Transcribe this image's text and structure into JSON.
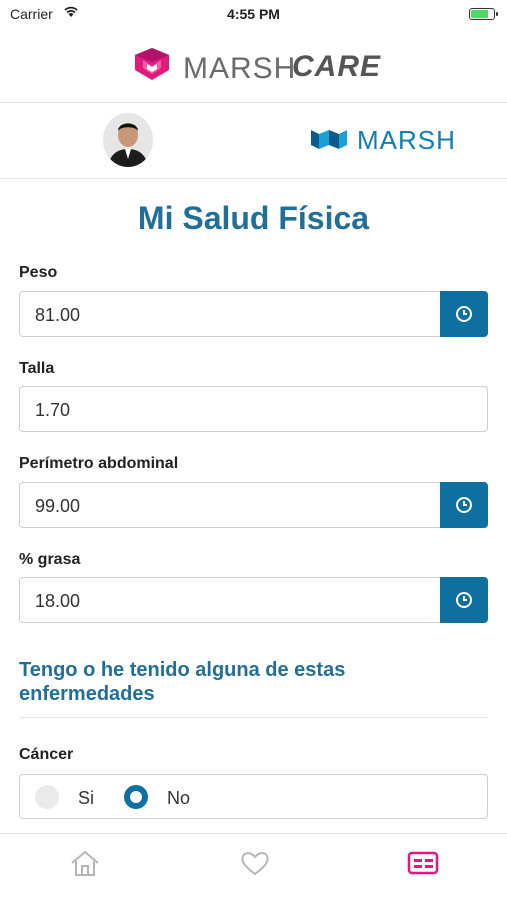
{
  "status_bar": {
    "carrier": "Carrier",
    "time": "4:55 PM"
  },
  "brand": {
    "name": "MARSH",
    "suffix": "CARE"
  },
  "partner": {
    "name": "MARSH"
  },
  "page": {
    "title": "Mi Salud Física"
  },
  "fields": [
    {
      "label": "Peso",
      "value": "81.00",
      "has_history": true
    },
    {
      "label": "Talla",
      "value": "1.70",
      "has_history": false
    },
    {
      "label": "Perímetro abdominal",
      "value": "99.00",
      "has_history": true
    },
    {
      "label": "% grasa",
      "value": "18.00",
      "has_history": true
    }
  ],
  "diseases": {
    "title": "Tengo o he tenido alguna de estas enfermedades",
    "items": [
      {
        "label": "Cáncer",
        "options": [
          "Si",
          "No"
        ],
        "selected": "No"
      }
    ]
  },
  "tabbar": {
    "items": [
      "home-icon",
      "heart-icon",
      "id-card-icon"
    ],
    "active": "id-card-icon"
  },
  "colors": {
    "primary": "#0e6fa0",
    "title": "#1f6f99",
    "brand_pink": "#e0197d",
    "active_tab": "#e0197d",
    "inactive_tab": "#b5b5b5"
  }
}
